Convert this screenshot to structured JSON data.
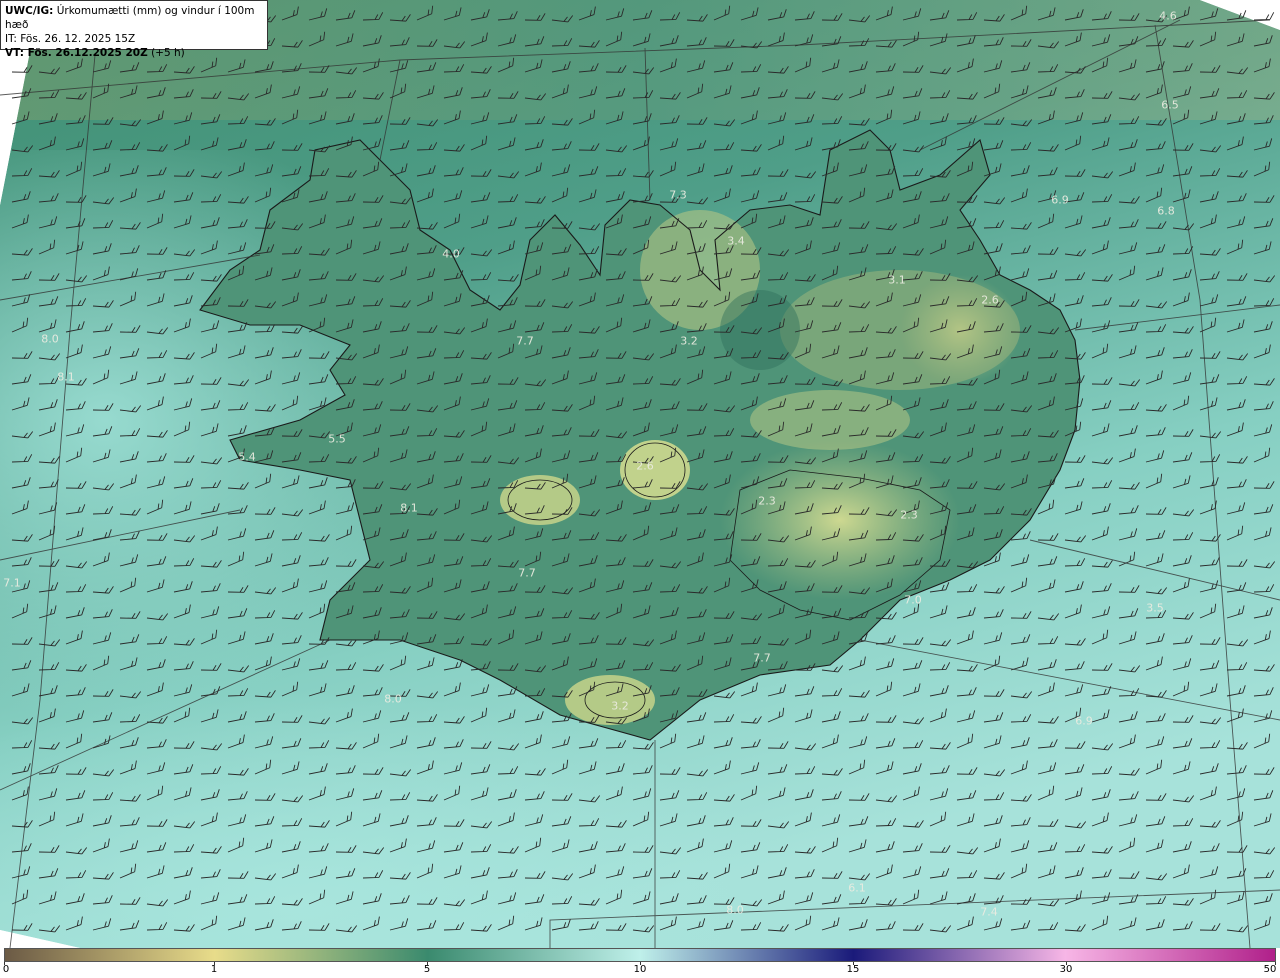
{
  "header": {
    "line1_bold": "UWC/IG:",
    "line1_rest": "Úrkomumætti (mm) og vindur í 100m hæð",
    "line2": "IT: Fös. 26. 12. 2025 15Z",
    "line3_bold": "VT: Fös. 26.12.2025 20Z",
    "line3_rest": "(+5 h)"
  },
  "map_values": [
    {
      "text": "4.6"
    },
    {
      "text": "6.5"
    },
    {
      "text": "6.9"
    },
    {
      "text": "6.8"
    },
    {
      "text": "7.3"
    },
    {
      "text": "3.4"
    },
    {
      "text": "4.0"
    },
    {
      "text": "3.1"
    },
    {
      "text": "2.6"
    },
    {
      "text": "3.2"
    },
    {
      "text": "7.7"
    },
    {
      "text": "8.0"
    },
    {
      "text": "8.1"
    },
    {
      "text": "5.5"
    },
    {
      "text": "5.4"
    },
    {
      "text": "2.6"
    },
    {
      "text": "2.3"
    },
    {
      "text": "2.3"
    },
    {
      "text": "8.1"
    },
    {
      "text": "7.7"
    },
    {
      "text": "7.1"
    },
    {
      "text": "7.0"
    },
    {
      "text": "3.5"
    },
    {
      "text": "7.7"
    },
    {
      "text": "8.0"
    },
    {
      "text": "3.2"
    },
    {
      "text": "6.9"
    },
    {
      "text": "6.1"
    },
    {
      "text": "8.0"
    },
    {
      "text": "7.4"
    }
  ],
  "colorbar": {
    "ticks": [
      "0",
      "1",
      "5",
      "10",
      "15",
      "30",
      "50"
    ],
    "colors": [
      "#6b5a45",
      "#e8dc8a",
      "#3a8a6e",
      "#bff0ea",
      "#1a1a7a",
      "#f7b6e6",
      "#b0208a"
    ]
  },
  "palette": {
    "ocean_dark": "#2f7a66",
    "ocean_light": "#8fd6c8",
    "land_yellow": "#c9d68a",
    "coast": "#1a1a1a",
    "barb": "#2a2a2a"
  }
}
